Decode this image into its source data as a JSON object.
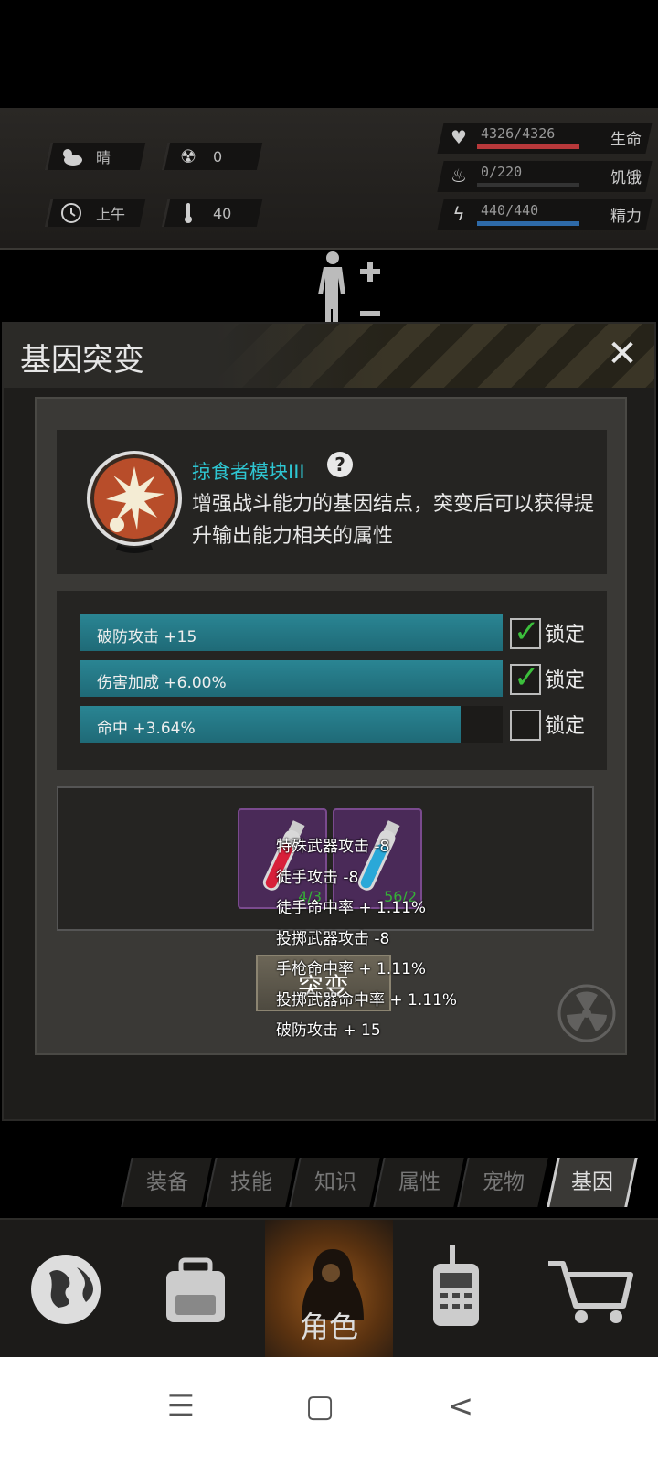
{
  "hud": {
    "weather": "晴",
    "radiation": "0",
    "time": "上午",
    "temperature": "40",
    "stats": [
      {
        "icon": "heart-icon",
        "value": "4326/4326",
        "name": "生命",
        "fill": 1.0,
        "color": "#b8383a"
      },
      {
        "icon": "stomach-icon",
        "value": "0/220",
        "name": "饥饿",
        "fill": 0.0,
        "color": "#8a6a2a"
      },
      {
        "icon": "energy-icon",
        "value": "440/440",
        "name": "精力",
        "fill": 1.0,
        "color": "#2e6aa8"
      }
    ]
  },
  "dialog": {
    "title": "基因突变",
    "gene": {
      "name": "掠食者模块III",
      "description": "增强战斗能力的基因结点，突变后可以获得提升输出能力相关的属性"
    },
    "attributes": [
      {
        "label": "破防攻击 +15",
        "fill": 1.0,
        "locked": true,
        "lock_label": "锁定"
      },
      {
        "label": "伤害加成 +6.00%",
        "fill": 1.0,
        "locked": true,
        "lock_label": "锁定"
      },
      {
        "label": "命中 +3.64%",
        "fill": 0.9,
        "locked": false,
        "lock_label": "锁定"
      }
    ],
    "items": [
      {
        "count": "4/3",
        "color": "red"
      },
      {
        "count": "56/2",
        "color": "blue"
      }
    ],
    "mutate_label": "突变",
    "tooltip": [
      "特殊武器攻击 -8",
      "徒手攻击 -8",
      "徒手命中率 + 1.11%",
      "投掷武器攻击 -8",
      "手枪命中率 + 1.11%",
      "投掷武器命中率 + 1.11%",
      "破防攻击 + 15"
    ]
  },
  "subtabs": [
    "装备",
    "技能",
    "知识",
    "属性",
    "宠物",
    "基因"
  ],
  "active_subtab": "基因",
  "bottom_nav": {
    "items": [
      "globe-icon",
      "backpack-icon",
      "character-icon",
      "radio-icon",
      "cart-icon"
    ],
    "active_label": "角色"
  }
}
